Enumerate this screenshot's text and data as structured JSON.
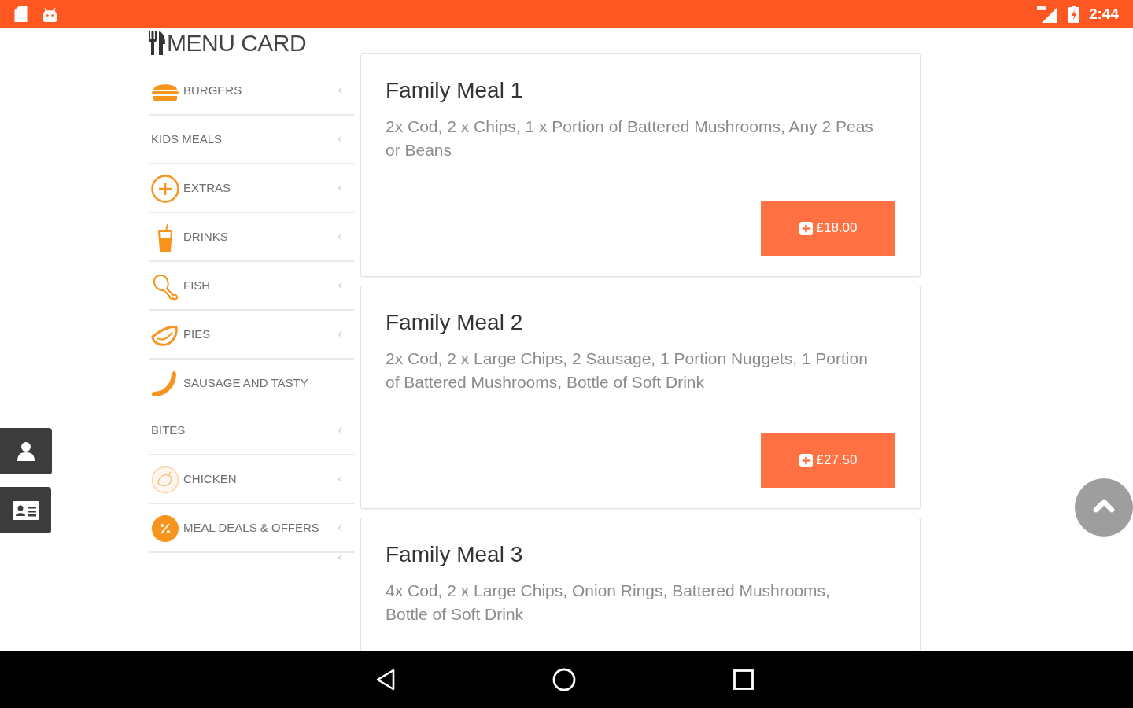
{
  "status_bar": {
    "time": "2:44"
  },
  "header": {
    "title": "MENU CARD"
  },
  "categories": [
    {
      "kind": "burger",
      "label": "BURGERS"
    },
    {
      "kind": "plain",
      "label": "KIDS MEALS"
    },
    {
      "kind": "extras",
      "label": "EXTRAS"
    },
    {
      "kind": "drink",
      "label": "DRINKS"
    },
    {
      "kind": "drumstick",
      "label": "FISH"
    },
    {
      "kind": "pasty",
      "label": "PIES"
    },
    {
      "kind": "sausage",
      "label": "SAUSAGE AND TASTY BITES"
    },
    {
      "kind": "chicken",
      "label": "CHICKEN"
    },
    {
      "kind": "offers",
      "label": "MEAL DEALS & OFFERS"
    },
    {
      "kind": "blank"
    }
  ],
  "meals": [
    {
      "title": "Family Meal 1",
      "description": "2x Cod, 2 x Chips, 1 x Portion of Battered Mushrooms, Any 2 Peas or Beans",
      "price": "£18.00"
    },
    {
      "title": "Family Meal 2",
      "description": "2x Cod, 2 x Large Chips, 2 Sausage, 1 Portion Nuggets, 1 Portion of Battered Mushrooms, Bottle of Soft Drink",
      "price": "£27.50"
    },
    {
      "title": "Family Meal 3",
      "description": "4x Cod, 2 x Large Chips, Onion Rings, Battered Mushrooms, Bottle of Soft Drink"
    }
  ]
}
